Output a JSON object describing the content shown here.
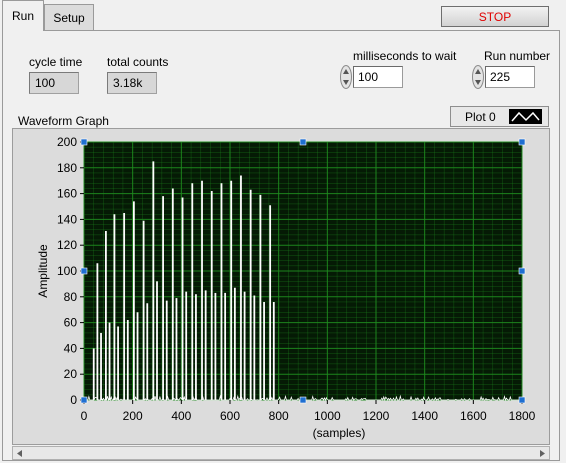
{
  "tabs": [
    {
      "label": "Run",
      "active": true
    },
    {
      "label": "Setup",
      "active": false
    }
  ],
  "stop_button": {
    "label": "STOP",
    "color": "#e00000"
  },
  "cycle_time": {
    "label": "cycle time",
    "value": "100"
  },
  "total_counts": {
    "label": "total counts",
    "value": "3.18k"
  },
  "ms_to_wait": {
    "label": "milliseconds to wait",
    "value": "100"
  },
  "run_number": {
    "label": "Run number",
    "value": "225"
  },
  "graph": {
    "title": "Waveform Graph",
    "legend_label": "Plot 0",
    "plot_bg": "#051a05",
    "grid_color": "#1f8a1f",
    "trace_color": "#ffffff"
  },
  "chart_data": {
    "type": "line",
    "xlabel": "(samples)",
    "ylabel": "Amplitude",
    "xlim": [
      0,
      1800
    ],
    "ylim": [
      0,
      200
    ],
    "xticks": [
      "0",
      "200",
      "400",
      "600",
      "800",
      "1000",
      "1200",
      "1400",
      "1600",
      "1800"
    ],
    "yticks": [
      "0",
      "20",
      "40",
      "60",
      "80",
      "100",
      "120",
      "140",
      "160",
      "180",
      "200"
    ],
    "series": [
      {
        "peaks": [
          {
            "x": 40,
            "y": 40
          },
          {
            "x": 55,
            "y": 106
          },
          {
            "x": 70,
            "y": 52
          },
          {
            "x": 90,
            "y": 131
          },
          {
            "x": 105,
            "y": 60
          },
          {
            "x": 125,
            "y": 144
          },
          {
            "x": 140,
            "y": 57
          },
          {
            "x": 165,
            "y": 145
          },
          {
            "x": 180,
            "y": 62
          },
          {
            "x": 205,
            "y": 154
          },
          {
            "x": 220,
            "y": 68
          },
          {
            "x": 245,
            "y": 139
          },
          {
            "x": 260,
            "y": 75
          },
          {
            "x": 285,
            "y": 185
          },
          {
            "x": 300,
            "y": 92
          },
          {
            "x": 325,
            "y": 158
          },
          {
            "x": 340,
            "y": 77
          },
          {
            "x": 365,
            "y": 164
          },
          {
            "x": 380,
            "y": 79
          },
          {
            "x": 405,
            "y": 157
          },
          {
            "x": 420,
            "y": 84
          },
          {
            "x": 445,
            "y": 168
          },
          {
            "x": 460,
            "y": 82
          },
          {
            "x": 485,
            "y": 170
          },
          {
            "x": 500,
            "y": 85
          },
          {
            "x": 525,
            "y": 162
          },
          {
            "x": 540,
            "y": 83
          },
          {
            "x": 565,
            "y": 168
          },
          {
            "x": 580,
            "y": 83
          },
          {
            "x": 605,
            "y": 170
          },
          {
            "x": 620,
            "y": 87
          },
          {
            "x": 645,
            "y": 174
          },
          {
            "x": 660,
            "y": 84
          },
          {
            "x": 685,
            "y": 163
          },
          {
            "x": 700,
            "y": 81
          },
          {
            "x": 725,
            "y": 159
          },
          {
            "x": 740,
            "y": 76
          },
          {
            "x": 765,
            "y": 151
          },
          {
            "x": 780,
            "y": 76
          }
        ],
        "noise_floor_max": 3
      }
    ]
  }
}
